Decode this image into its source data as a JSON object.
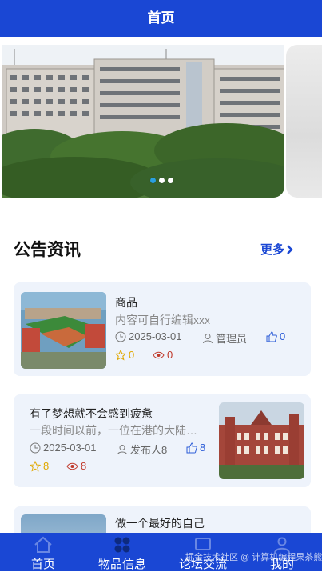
{
  "header": {
    "title": "首页"
  },
  "carousel": {
    "dot_count": 3,
    "active_index": 0
  },
  "notices": {
    "title": "公告资讯",
    "more_label": "更多",
    "items": [
      {
        "title": "商品",
        "summary": "内容可自行编辑xxx",
        "date": "2025-03-01",
        "author": "管理员",
        "likes": "0",
        "favorites": "0",
        "views": "0"
      },
      {
        "title": "有了梦想就不会感到疲惫",
        "summary": "一段时间以前，一位在港的大陆…",
        "date": "2025-03-01",
        "author": "发布人8",
        "likes": "8",
        "favorites": "8",
        "views": "8"
      },
      {
        "title": "做一个最好的自己"
      }
    ]
  },
  "tabbar": {
    "tabs": [
      {
        "label": "首页",
        "icon": "home-icon"
      },
      {
        "label": "物品信息",
        "icon": "grid-icon"
      },
      {
        "label": "论坛交流",
        "icon": "forum-icon"
      },
      {
        "label": "我的",
        "icon": "user-icon"
      }
    ]
  },
  "watermark": "掘金技术社区 @ 计算机编程果茶熊",
  "colors": {
    "primary": "#1a47d4",
    "card_bg": "#eef3fb",
    "accent_blue": "#2a5bd7",
    "star": "#e0a800",
    "eye": "#c0392b"
  }
}
